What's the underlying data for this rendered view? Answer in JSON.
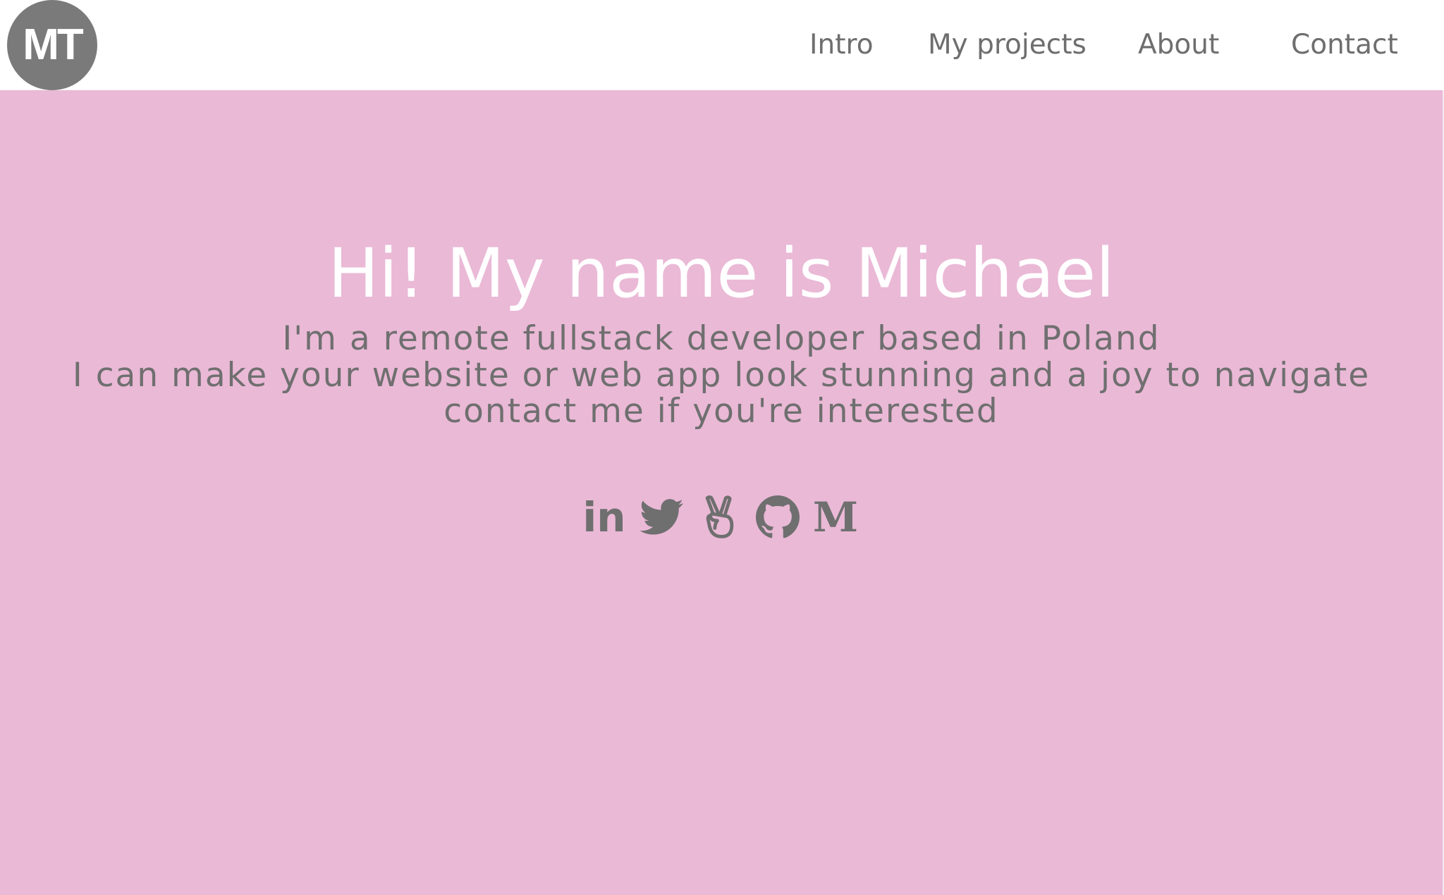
{
  "logo": {
    "text": "MT"
  },
  "nav": {
    "items": [
      {
        "label": "Intro"
      },
      {
        "label": "My projects"
      },
      {
        "label": "About"
      },
      {
        "label": "Contact"
      }
    ]
  },
  "hero": {
    "title": "Hi! My name is Michael",
    "lines": [
      "I'm a remote fullstack developer based in Poland",
      "I can make your website or web app look stunning and a joy to navigate",
      "contact me if you're interested"
    ]
  },
  "socials": {
    "linkedin": "in",
    "medium": "M",
    "icons": [
      "linkedin-icon",
      "twitter-icon",
      "angellist-icon",
      "github-icon",
      "medium-icon"
    ]
  },
  "colors": {
    "hero_background": "#eab9d6",
    "text_gray": "#6f6f6f",
    "logo_background": "#7a7a7a",
    "title_color": "#ffffff"
  }
}
